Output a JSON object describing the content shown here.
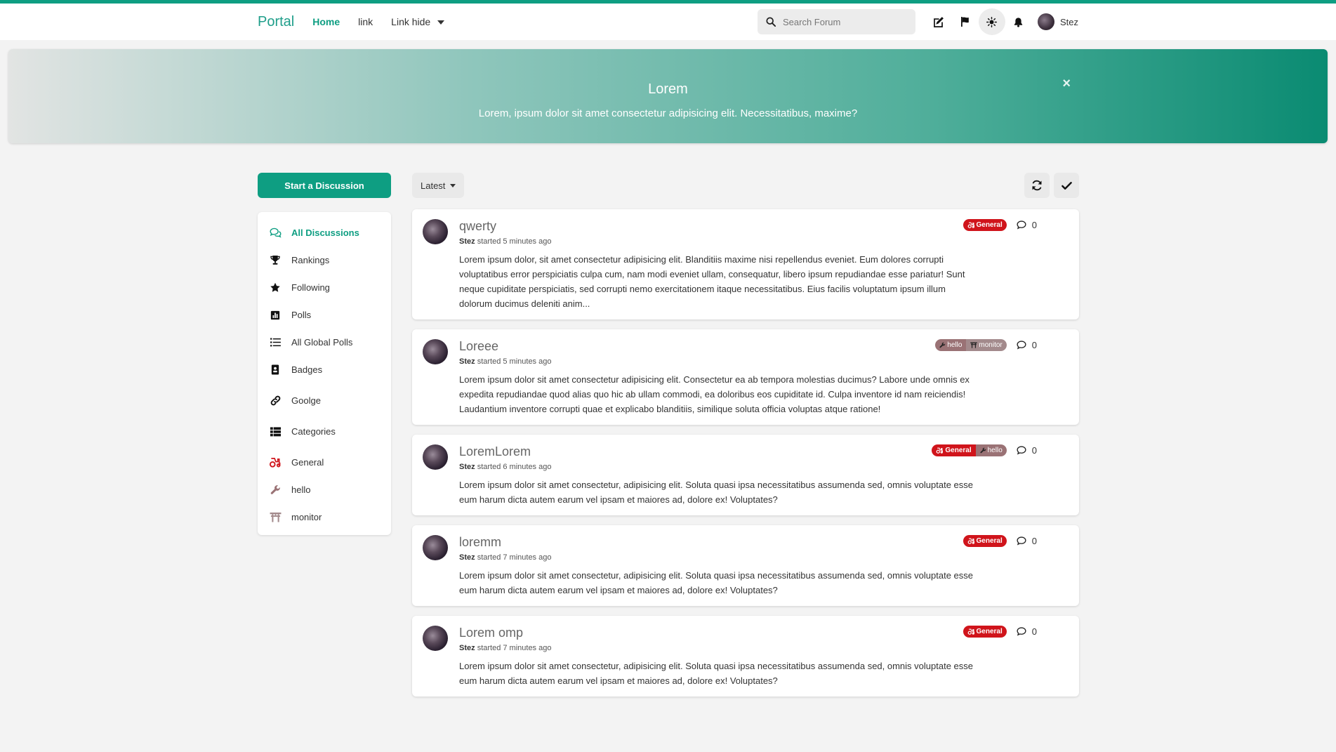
{
  "header": {
    "brand": "Portal",
    "nav": [
      {
        "label": "Home"
      },
      {
        "label": "link"
      },
      {
        "label": "Link hide"
      }
    ],
    "search_placeholder": "Search Forum",
    "username": "Stez"
  },
  "hero": {
    "title": "Lorem",
    "subtitle": "Lorem, ipsum dolor sit amet consectetur adipisicing elit. Necessitatibus, maxime?",
    "close": "×"
  },
  "sidebar": {
    "start_button": "Start a Discussion",
    "items": [
      {
        "label": "All Discussions"
      },
      {
        "label": "Rankings"
      },
      {
        "label": "Following"
      },
      {
        "label": "Polls"
      },
      {
        "label": "All Global Polls"
      },
      {
        "label": "Badges"
      },
      {
        "label": "Goolge"
      },
      {
        "label": "Categories"
      },
      {
        "label": "General"
      },
      {
        "label": "hello"
      },
      {
        "label": "monitor"
      }
    ]
  },
  "toolbar": {
    "sort_label": "Latest"
  },
  "colors": {
    "accent": "#0e9e82",
    "tag_general": "#d0141b",
    "tag_hello": "#9a7275",
    "tag_monitor": "#a38a8c"
  },
  "discussions": [
    {
      "title": "qwerty",
      "author": "Stez",
      "meta": "started 5 minutes ago",
      "body": "Lorem ipsum dolor, sit amet consectetur adipisicing elit. Blanditiis maxime nisi repellendus eveniet. Eum dolores corrupti voluptatibus error perspiciatis culpa cum, nam modi eveniet ullam, consequatur, libero ipsum repudiandae esse pariatur! Sunt neque cupiditate perspiciatis, sed corrupti nemo exercitationem itaque necessitatibus. Eius facilis voluptatum ipsum illum dolorum ducimus deleniti anim...",
      "tags": [
        "General"
      ],
      "replies": "0"
    },
    {
      "title": "Loreee",
      "author": "Stez",
      "meta": "started 5 minutes ago",
      "body": "Lorem ipsum dolor sit amet consectetur adipisicing elit. Consectetur ea ab tempora molestias ducimus? Labore unde omnis ex expedita repudiandae quod alias quo hic ab ullam commodi, ea doloribus eos cupiditate id. Culpa inventore id nam reiciendis! Laudantium inventore corrupti quae et explicabo blanditiis, similique soluta officia voluptas atque ratione!",
      "tags": [
        "hello",
        "monitor"
      ],
      "replies": "0"
    },
    {
      "title": "LoremLorem",
      "author": "Stez",
      "meta": "started 6 minutes ago",
      "body": "Lorem ipsum dolor sit amet consectetur, adipisicing elit. Soluta quasi ipsa necessitatibus assumenda sed, omnis voluptate esse eum harum dicta autem earum vel ipsam et maiores ad, dolore ex! Voluptates?",
      "tags": [
        "General",
        "hello"
      ],
      "replies": "0"
    },
    {
      "title": "loremm",
      "author": "Stez",
      "meta": "started 7 minutes ago",
      "body": "Lorem ipsum dolor sit amet consectetur, adipisicing elit. Soluta quasi ipsa necessitatibus assumenda sed, omnis voluptate esse eum harum dicta autem earum vel ipsam et maiores ad, dolore ex! Voluptates?",
      "tags": [
        "General"
      ],
      "replies": "0"
    },
    {
      "title": "Lorem omp",
      "author": "Stez",
      "meta": "started 7 minutes ago",
      "body": "Lorem ipsum dolor sit amet consectetur, adipisicing elit. Soluta quasi ipsa necessitatibus assumenda sed, omnis voluptate esse eum harum dicta autem earum vel ipsam et maiores ad, dolore ex! Voluptates?",
      "tags": [
        "General"
      ],
      "replies": "0"
    }
  ]
}
